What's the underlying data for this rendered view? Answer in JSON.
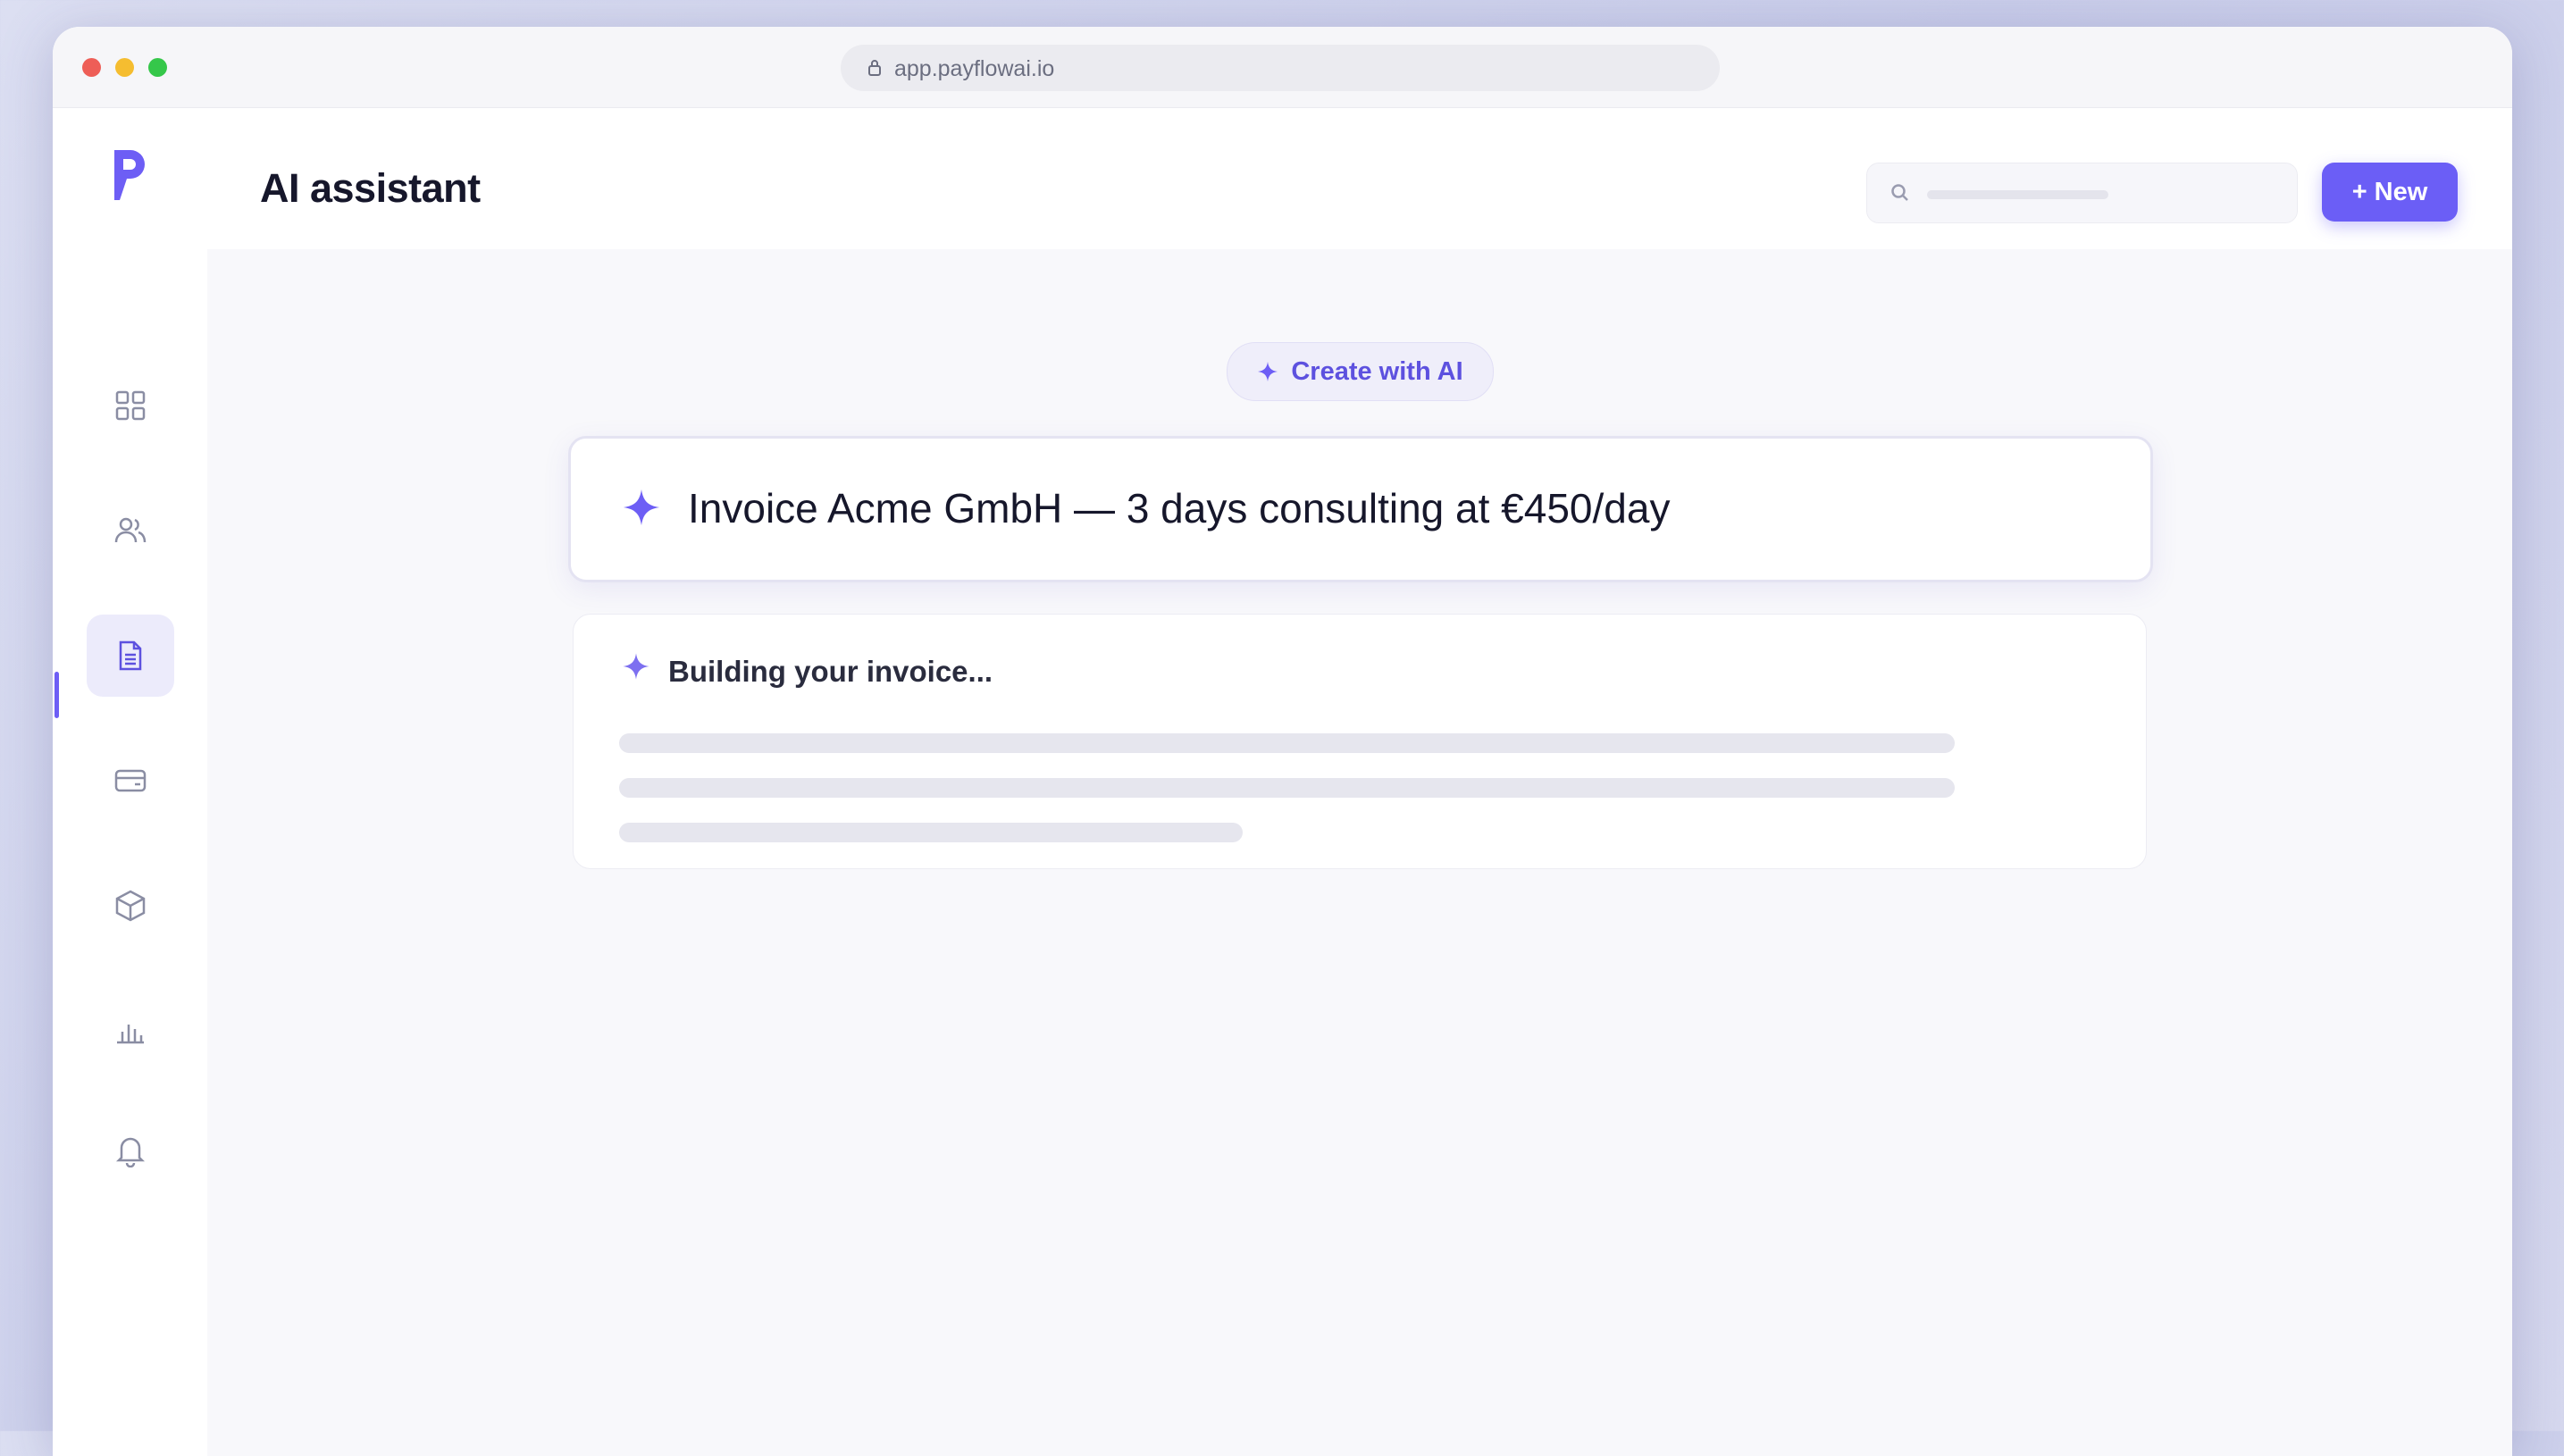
{
  "browser": {
    "url": "app.payflowai.io"
  },
  "sidebar": {
    "logo": "payflow-logo-icon",
    "items": [
      {
        "icon": "dashboard-grid-icon",
        "active": false
      },
      {
        "icon": "users-icon",
        "active": false
      },
      {
        "icon": "document-icon",
        "active": true
      },
      {
        "icon": "credit-card-icon",
        "active": false
      },
      {
        "icon": "box-icon",
        "active": false
      },
      {
        "icon": "bar-chart-icon",
        "active": false
      },
      {
        "icon": "bell-icon",
        "active": false
      }
    ]
  },
  "header": {
    "title": "AI assistant",
    "new_button_label": "+ New"
  },
  "main": {
    "create_pill_label": "Create with AI",
    "prompt_text": "Invoice Acme GmbH — 3 days consulting at €450/day",
    "result_title": "Building your invoice..."
  },
  "colors": {
    "accent": "#6b5ef6",
    "sparkle": "#6d5ef5"
  }
}
